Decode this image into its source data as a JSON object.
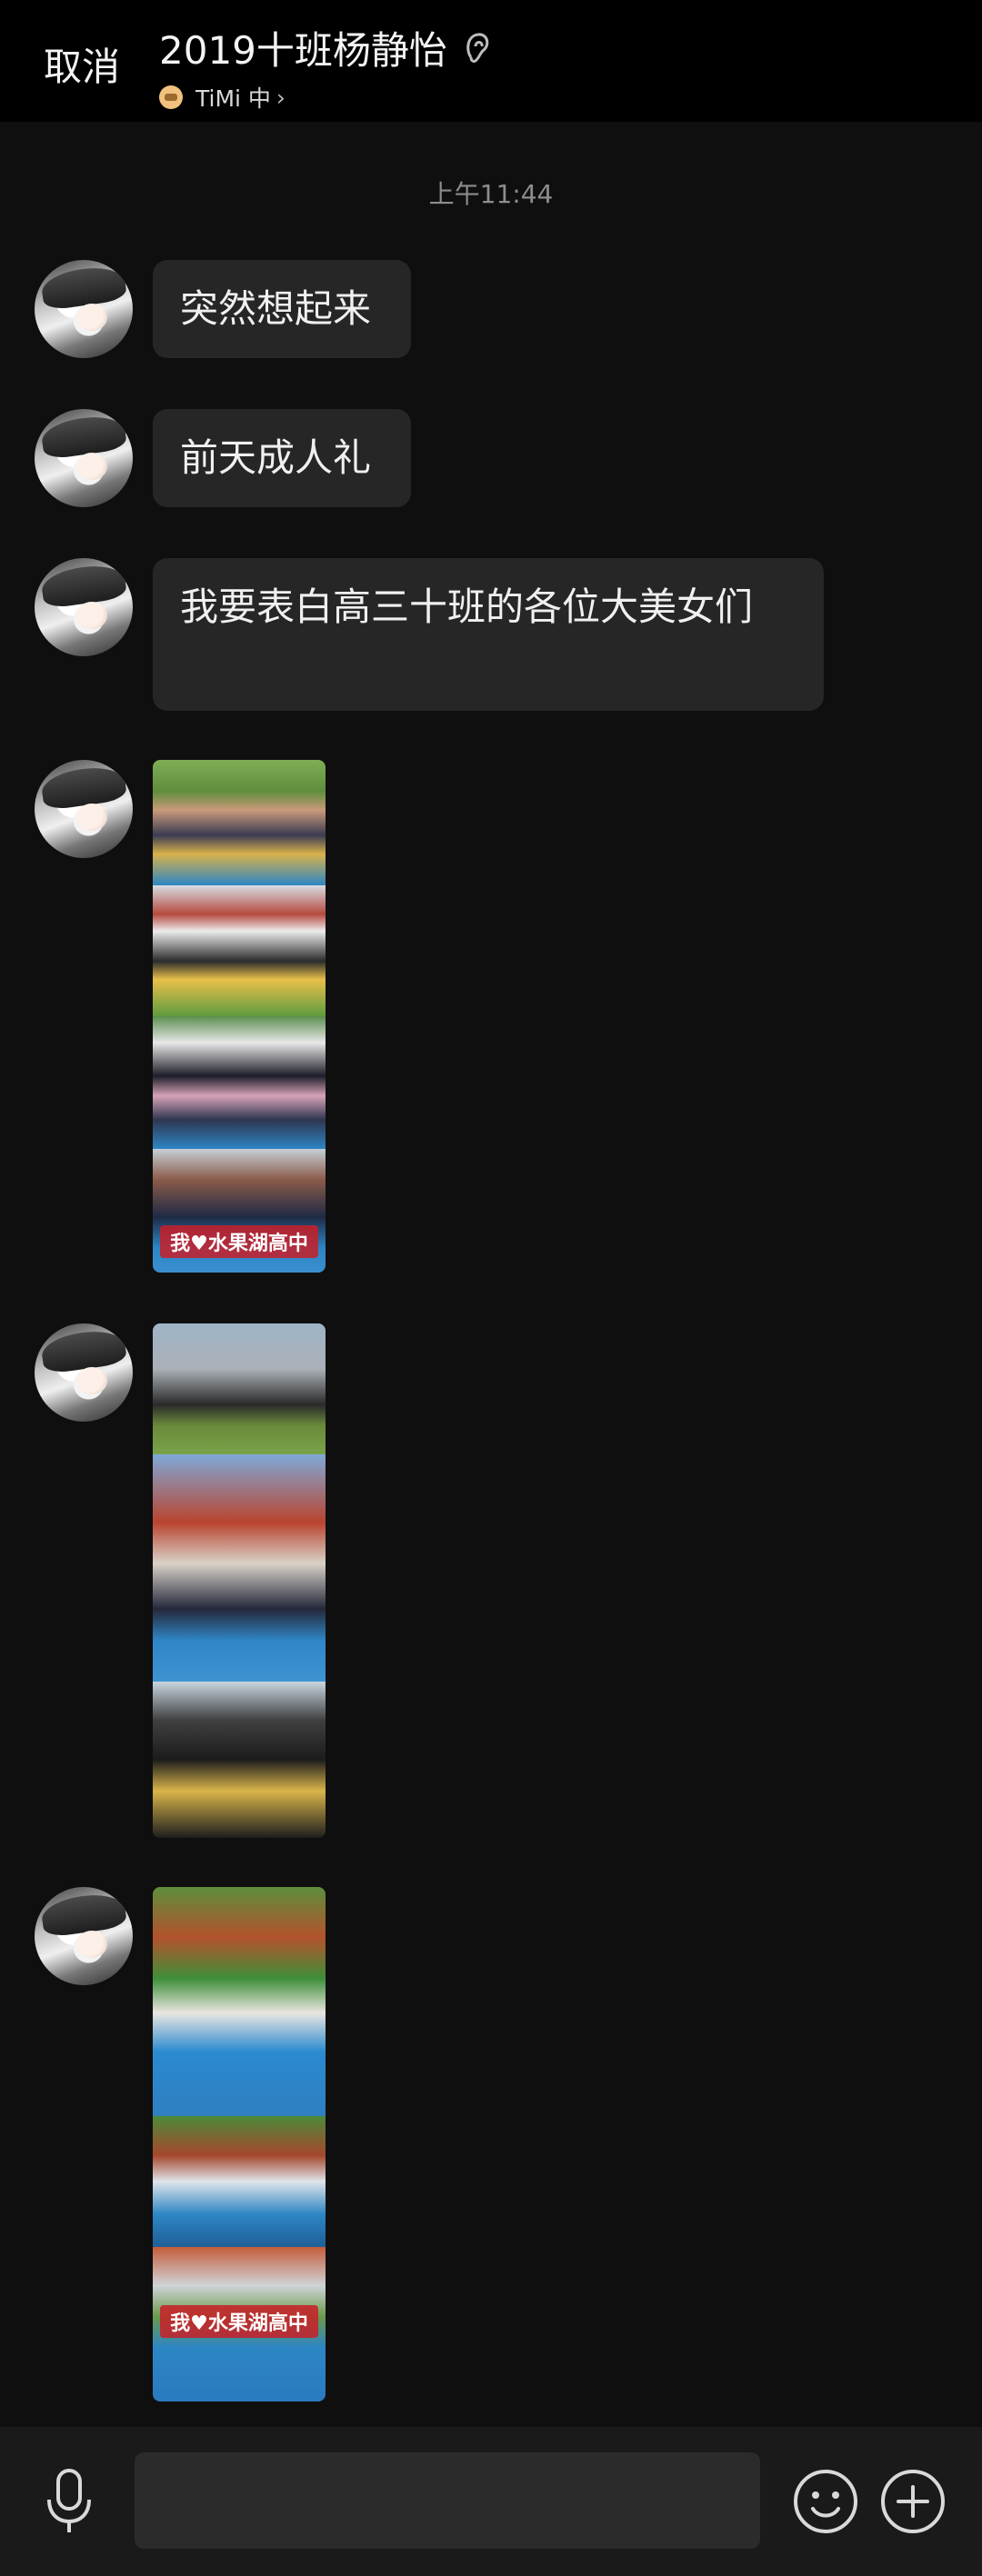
{
  "header": {
    "cancel_label": "取消",
    "title": "2019十班杨静怡",
    "status_icon": "ear-icon",
    "sub_status": "TiMi 中",
    "sub_status_chevron": "›"
  },
  "chat": {
    "timestamp": "上午11:44",
    "messages": [
      {
        "type": "text",
        "text": "突然想起来"
      },
      {
        "type": "text",
        "text": "前天成人礼"
      },
      {
        "type": "text",
        "text": "我要表白高三十班的各位大美女们"
      },
      {
        "type": "images",
        "banner": "我♥水果湖高中"
      },
      {
        "type": "images"
      },
      {
        "type": "images",
        "banner": "我♥水果湖高中"
      }
    ]
  },
  "input_bar": {
    "mic_icon": "microphone-icon",
    "input_placeholder": "",
    "emoji_icon": "emoji-icon",
    "plus_icon": "plus-icon"
  }
}
